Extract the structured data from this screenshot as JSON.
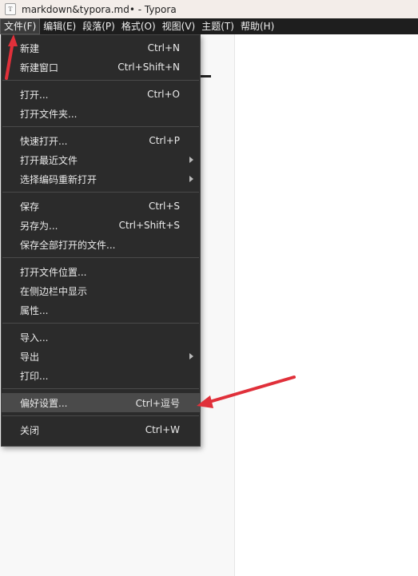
{
  "window": {
    "title": "markdown&typora.md• - Typora",
    "icon_letter": "T"
  },
  "menubar": {
    "items": [
      {
        "label": "文件(F)",
        "active": true
      },
      {
        "label": "编辑(E)"
      },
      {
        "label": "段落(P)"
      },
      {
        "label": "格式(O)"
      },
      {
        "label": "视图(V)"
      },
      {
        "label": "主题(T)"
      },
      {
        "label": "帮助(H)"
      }
    ]
  },
  "file_menu": {
    "new": {
      "label": "新建",
      "shortcut": "Ctrl+N"
    },
    "new_window": {
      "label": "新建窗口",
      "shortcut": "Ctrl+Shift+N"
    },
    "open": {
      "label": "打开...",
      "shortcut": "Ctrl+O"
    },
    "open_folder": {
      "label": "打开文件夹..."
    },
    "quick_open": {
      "label": "快速打开...",
      "shortcut": "Ctrl+P"
    },
    "open_recent": {
      "label": "打开最近文件"
    },
    "reopen_encoding": {
      "label": "选择编码重新打开"
    },
    "save": {
      "label": "保存",
      "shortcut": "Ctrl+S"
    },
    "save_as": {
      "label": "另存为...",
      "shortcut": "Ctrl+Shift+S"
    },
    "save_all": {
      "label": "保存全部打开的文件..."
    },
    "open_location": {
      "label": "打开文件位置..."
    },
    "show_in_sidebar": {
      "label": "在侧边栏中显示"
    },
    "properties": {
      "label": "属性..."
    },
    "import": {
      "label": "导入..."
    },
    "export": {
      "label": "导出"
    },
    "print": {
      "label": "打印..."
    },
    "preferences": {
      "label": "偏好设置...",
      "shortcut": "Ctrl+逗号"
    },
    "close": {
      "label": "关闭",
      "shortcut": "Ctrl+W"
    }
  },
  "colors": {
    "menubar_bg": "#1e1e1e",
    "dropdown_bg": "#2b2b2b",
    "highlight_bg": "#4a4a4a",
    "annotation_arrow": "#e0303a"
  }
}
